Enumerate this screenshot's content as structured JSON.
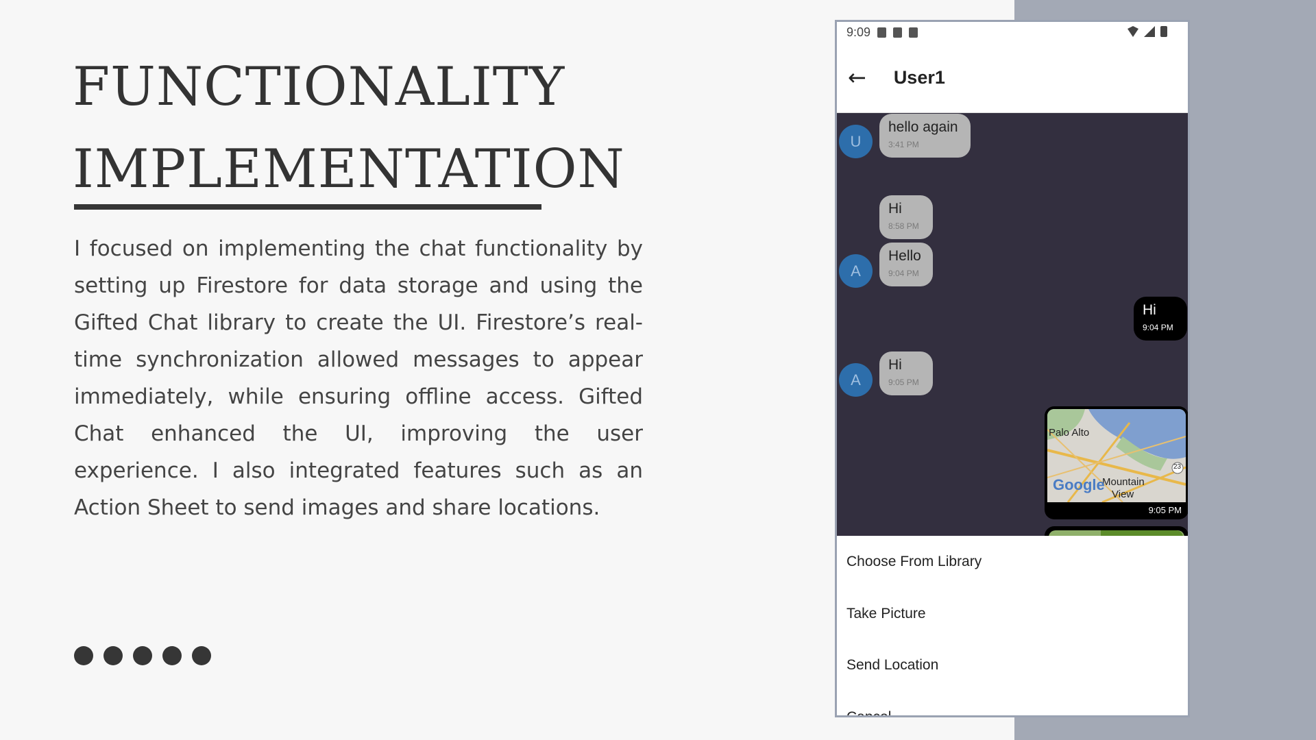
{
  "slide": {
    "title_line1": "FUNCTIONALITY",
    "title_line2": "IMPLEMENTATION",
    "body": "I focused on implementing the chat functionality by setting up Firestore for data storage and using the Gifted Chat library to create the UI. Firestore’s real-time synchronization allowed messages to appear immediately, while ensuring offline access. Gifted Chat enhanced the UI, improving the user experience. I also integrated features such as an Action Sheet to send images and share locations."
  },
  "colors": {
    "panel": "#a3a9b5",
    "chat_background": "#332f3f",
    "incoming_bubble": "#b5b5b5",
    "outgoing_bubble": "#000000",
    "avatar": "#2d6eab"
  },
  "phone": {
    "status_time": "9:09",
    "header": {
      "back_icon": "←",
      "title": "User1"
    },
    "messages": [
      {
        "text": "hello again",
        "time": "3:41 PM",
        "avatar": "U"
      },
      {
        "text": "Hi",
        "time": "8:58 PM"
      },
      {
        "text": "Hello",
        "time": "9:04 PM",
        "avatar": "A"
      },
      {
        "text": "Hi",
        "time": "9:04 PM"
      },
      {
        "text": "Hi",
        "time": "9:05 PM",
        "avatar": "A"
      }
    ],
    "map_message": {
      "place1": "Palo Alto",
      "place2": "Mountain",
      "place3": "View",
      "logo": "Google",
      "road_badge": "23",
      "time": "9:05 PM"
    },
    "action_sheet": [
      "Choose From Library",
      "Take Picture",
      "Send Location",
      "Cancel"
    ]
  }
}
